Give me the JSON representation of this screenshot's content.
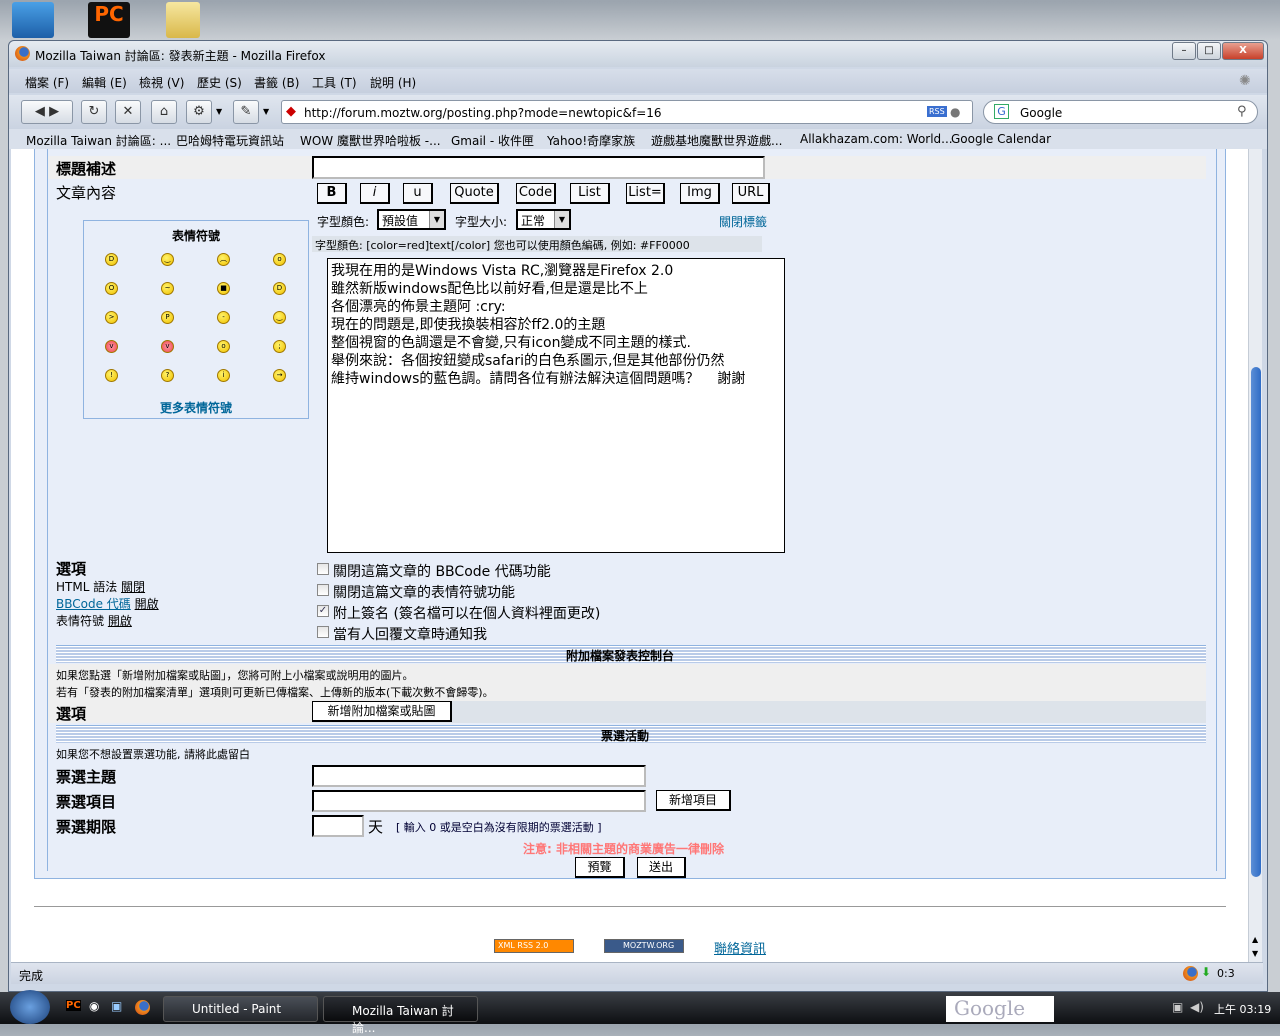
{
  "window": {
    "title": "Mozilla Taiwan 討論區: 發表新主題 - Mozilla Firefox",
    "min": "–",
    "max": "□",
    "close": "X"
  },
  "menu": [
    "檔案 (F)",
    "編輯 (E)",
    "檢視 (V)",
    "歷史 (S)",
    "書籤 (B)",
    "工具 (T)",
    "說明 (H)"
  ],
  "nav": {
    "url": "http://forum.moztw.org/posting.php?mode=newtopic&f=16",
    "rss": "RSS",
    "search": "Google"
  },
  "bookmarks": [
    "Mozilla Taiwan 討論區: ...",
    "巴哈姆特電玩資訊站",
    "WOW 魔獸世界哈啦板 -...",
    "Gmail - 收件匣",
    "Yahoo!奇摩家族",
    "遊戲基地魔獸世界遊戲...",
    "Allakhazam.com: World...",
    "Google Calendar"
  ],
  "form": {
    "subtitle_label": "標題補述",
    "subtitle_value": "",
    "body_label": "文章內容",
    "bbcode_buttons": [
      "B",
      "i",
      "u",
      "Quote",
      "Code",
      "List",
      "List=",
      "Img",
      "URL"
    ],
    "font_color_label": "字型顏色:",
    "font_color_value": "預設值",
    "font_size_label": "字型大小:",
    "font_size_value": "正常",
    "close_tags": "關閉標籤",
    "help_line": "字型顏色: [color=red]text[/color]  您也可以使用顏色編碼, 例如: #FF0000",
    "smilies_title": "表情符號",
    "smilies": [
      "grin",
      "smile",
      "sad",
      "surprised",
      "shocked",
      "confused",
      "cool",
      "laugh",
      "mad",
      "razz",
      "embarrassed",
      "cry",
      "evil",
      "twisted",
      "rolleyes",
      "wink",
      "exclaim",
      "question",
      "idea",
      "arrow"
    ],
    "more_smilies": "更多表情符號",
    "post_text": "我現在用的是Windows Vista RC,瀏覽器是Firefox 2.0\n雖然新版windows配色比以前好看,但是還是比不上\n各個漂亮的佈景主題阿 :cry:\n現在的問題是,即使我換裝相容於ff2.0的主題\n整個視窗的色調還是不會變,只有icon變成不同主題的樣式.\n舉例來說：各個按鈕變成safari的白色系圖示,但是其他部份仍然\n維持windows的藍色調。請問各位有辦法解決這個問題嗎？    謝謝",
    "options_label": "選項",
    "html_status": "HTML 語法",
    "html_state": "關閉",
    "bbcode_status": "BBCode 代碼",
    "bbcode_state": "開啟",
    "smilies_status": "表情符號",
    "smilies_state": "開啟",
    "checkboxes": [
      {
        "label": "關閉這篇文章的 BBCode 代碼功能",
        "checked": false
      },
      {
        "label": "關閉這篇文章的表情符號功能",
        "checked": false
      },
      {
        "label": "附上簽名 (簽名檔可以在個人資料裡面更改)",
        "checked": true
      },
      {
        "label": "當有人回覆文章時通知我",
        "checked": false
      }
    ],
    "attach_header": "附加檔案發表控制台",
    "attach_info1": "如果您點選「新增附加檔案或貼圖」，您將可附上小檔案或說明用的圖片。",
    "attach_info2": "若有「發表的附加檔案清單」選項則可更新已傳檔案、上傳新的版本(下載次數不會歸零)。",
    "attach_options_label": "選項",
    "attach_button": "新增附加檔案或貼圖",
    "poll_header": "票選活動",
    "poll_info": "如果您不想設置票選功能, 請將此處留白",
    "poll_question_label": "票選主題",
    "poll_option_label": "票選項目",
    "poll_add_button": "新增項目",
    "poll_length_label": "票選期限",
    "poll_days": "天",
    "poll_length_hint": "[ 輸入 0 或是空白為沒有限期的票選活動 ]",
    "warning": "注意: 非相關主題的商業廣告一律刪除",
    "preview": "預覽",
    "submit": "送出"
  },
  "footer": {
    "rss_badge": "XML RSS 2.0",
    "moztw_badge": "MOZTW.ORG",
    "contact": "聯絡資訊"
  },
  "status": {
    "text": "完成",
    "time": "0:3"
  },
  "taskbar": {
    "tasks": [
      "Untitled - Paint",
      "Mozilla Taiwan 討論..."
    ],
    "search": "Google",
    "clock": "上午 03:19"
  }
}
